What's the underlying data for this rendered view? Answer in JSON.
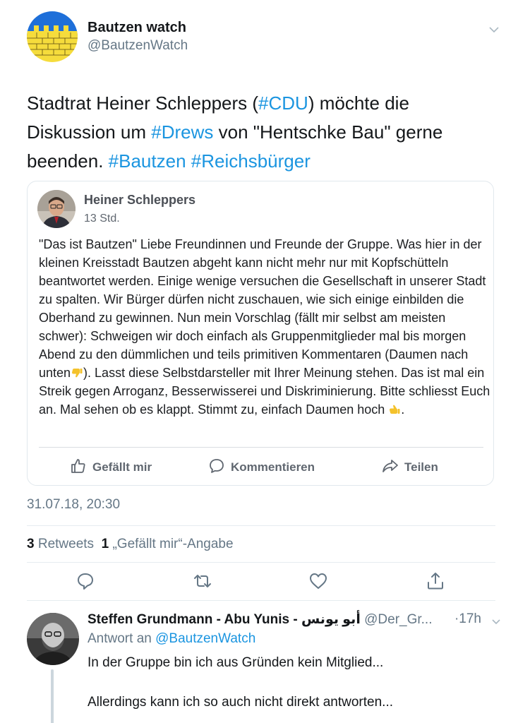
{
  "tweet": {
    "author_name": "Bautzen watch",
    "author_handle": "@BautzenWatch",
    "text": [
      {
        "t": "Stadtrat Heiner Schleppers (",
        "tag": false
      },
      {
        "t": "#CDU",
        "tag": true
      },
      {
        "t": ") möchte die Diskussion um ",
        "tag": false
      },
      {
        "t": "#Drews",
        "tag": true
      },
      {
        "t": " von \"Hentschke Bau\" gerne beenden. ",
        "tag": false
      },
      {
        "t": "#Bautzen",
        "tag": true
      },
      {
        "t": " ",
        "tag": false
      },
      {
        "t": "#Reichsbürger",
        "tag": true
      }
    ],
    "timestamp": "31.07.18, 20:30",
    "retweets_count": "3",
    "retweets_label": "Retweets",
    "likes_count": "1",
    "likes_label": "„Gefällt mir“-Angabe"
  },
  "embedded": {
    "name": "Heiner Schleppers",
    "time": "13 Std.",
    "body_part1": "\"Das ist Bautzen\" Liebe Freundinnen und Freunde der Gruppe. Was hier in der kleinen Kreisstadt Bautzen abgeht kann nicht mehr nur mit Kopfschütteln beantwortet werden. Einige wenige versuchen die Gesellschaft in unserer Stadt zu spalten. Wir Bürger dürfen nicht zuschauen, wie sich einige einbilden die Oberhand zu gewinnen. Nun mein Vorschlag (fällt mir selbst am meisten schwer): Schweigen wir doch einfach als Gruppenmitglieder mal bis morgen Abend zu den dümmlichen und teils primitiven Kommentaren (Daumen nach unten",
    "body_part2": "). Lasst diese Selbstdarsteller mit Ihrer Meinung stehen. Das ist mal ein Streik gegen Arroganz, Besserwisserei und Diskriminierung. Bitte schliesst Euch an. Mal sehen ob es klappt. Stimmt zu, einfach Daumen hoch",
    "body_part3": ".",
    "like_label": "Gefällt mir",
    "comment_label": "Kommentieren",
    "share_label": "Teilen"
  },
  "reply": {
    "name": "Steffen Grundmann - Abu Yunis - أبو يونس",
    "handle": "@Der_Gr...",
    "time": "·17h",
    "reply_to_prefix": "Antwort an",
    "reply_to_mention": "@BautzenWatch",
    "line1": "In der Gruppe bin ich aus Gründen kein Mitglied...",
    "line2": "Allerdings kann ich so auch nicht direkt antworten..."
  },
  "icons": [
    "caret-down-icon",
    "reply-icon",
    "retweet-icon",
    "like-icon",
    "share-icon",
    "thumbs-up-icon",
    "comment-icon",
    "share-arrow-icon",
    "thumbs-down-emoji",
    "thumbs-up-emoji"
  ],
  "colors": {
    "link": "#1b95e0",
    "secondary": "#657786",
    "crest_blue": "#1e6fd9",
    "crest_yellow": "#f5dc3c"
  }
}
